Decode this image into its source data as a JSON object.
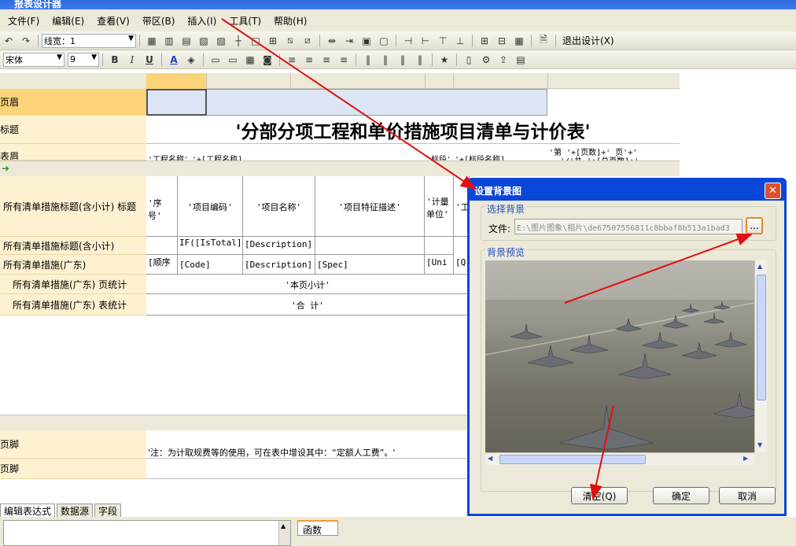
{
  "window": {
    "title": "报表设计器"
  },
  "menubar": {
    "items": [
      {
        "label": "文件(F)"
      },
      {
        "label": "编辑(E)"
      },
      {
        "label": "查看(V)"
      },
      {
        "label": "带区(B)"
      },
      {
        "label": "插入(I)"
      },
      {
        "label": "工具(T)"
      },
      {
        "label": "帮助(H)"
      }
    ]
  },
  "toolbar1": {
    "line_width_label": "线宽：1",
    "exit_label": "退出设计(X)"
  },
  "toolbar2": {
    "font_name": "宋体",
    "font_size": "9",
    "bold": "B",
    "italic": "I",
    "underline": "U"
  },
  "bands": {
    "page_header": "页眉",
    "title": "标题",
    "table_header": "表眉",
    "group_title": "所有清单措施标题(含小计) 标题",
    "group_subtotal": "所有清单措施标题(含小计)",
    "detail": "所有清单措施(广东)",
    "page_total": "所有清单措施(广东) 页统计",
    "table_total": "所有清单措施(广东) 表统计",
    "page_footer": "页脚",
    "page_footer2": "页脚"
  },
  "report": {
    "title_text": "'分部分项工程和单价措施项目清单与计价表'",
    "header_left": "'工程名称：'+[工程名称]",
    "header_mid": "标段：'+[标段名称]",
    "header_right1": "'第  '+[页数]+'  页'+'",
    "header_right2": "'/'共 '+[总页数]+'",
    "col_headers": [
      "'序号'",
      "'项目编码'",
      "'项目名称'",
      "'项目特征描述'",
      "'计量单位'",
      "'工"
    ],
    "subtotal_row": [
      "IF([IsTotal],",
      "[Description]"
    ],
    "detail_row": [
      "[顺序",
      "[Code]",
      "[Description]",
      "[Spec]",
      "[Uni",
      "[Q"
    ],
    "page_total_text": "'本页小计'",
    "table_total_text": "'合    计'",
    "footer_text": "'注：为计取规费等的使用，可在表中增设其中：“定额人工费”。'"
  },
  "dialog": {
    "title": "设置背景图",
    "group_select": "选择背景",
    "file_label": "文件:",
    "file_path": "E:\\图片图象\\相片\\de67507556811c8bbaf8b513a1bad3",
    "browse": "...",
    "group_preview": "背景预览",
    "clear_button": "清空(Q)",
    "ok_button": "确定",
    "cancel_button": "取消"
  },
  "bottom_tabs": [
    "编辑表达式",
    "数据源",
    "字段"
  ],
  "bottom_panel": {
    "func_label": "函数"
  },
  "colors": {
    "title_blue": "#0a46d8",
    "band_bg": "#fdf1d1",
    "band_highlight": "#fbd47a",
    "arrow_red": "#e01010"
  }
}
